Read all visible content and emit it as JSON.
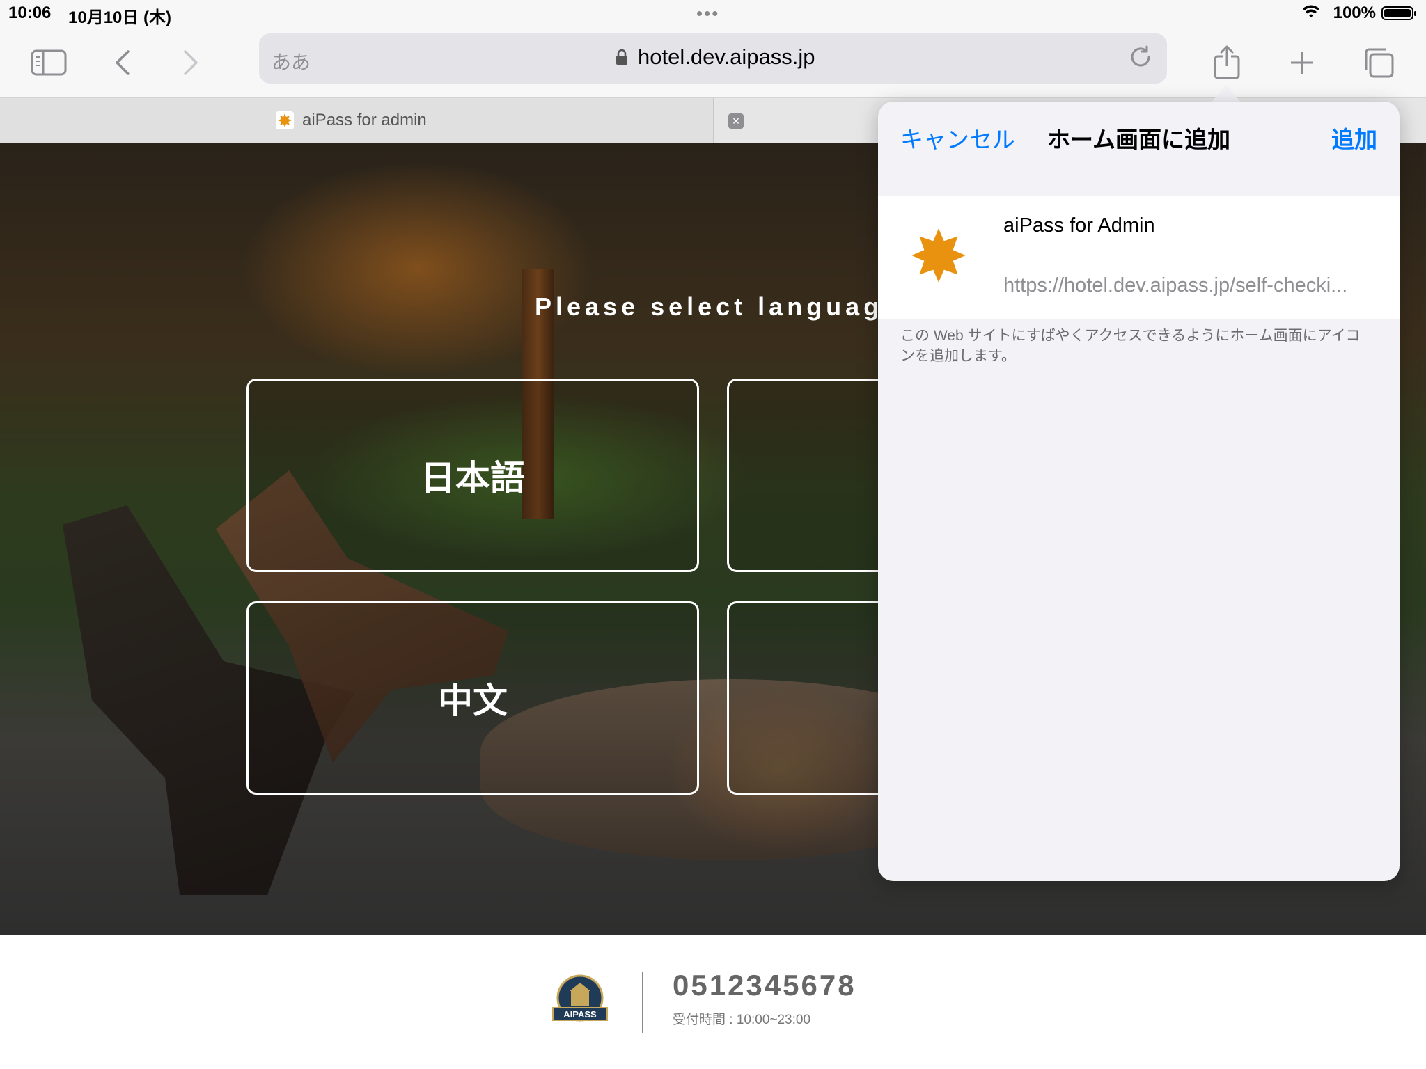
{
  "status_bar": {
    "time": "10:06",
    "date": "10月10日 (木)",
    "dots": "•••",
    "battery": "100%",
    "battery_level": 1.0
  },
  "browser": {
    "text_size_label": "ああ",
    "url": "hotel.dev.aipass.jp",
    "tab_title": "aiPass for admin",
    "tab_close": "×"
  },
  "page": {
    "prompt": "Please select language",
    "languages": [
      "日本語",
      "中文"
    ],
    "footer": {
      "phone": "0512345678",
      "hours": "受付時間 : 10:00~23:00",
      "logo_text": "AIPASS"
    }
  },
  "add_to_home_sheet": {
    "cancel": "キャンセル",
    "title": "ホーム画面に追加",
    "add": "追加",
    "app_name": "aiPass for Admin",
    "app_url": "https://hotel.dev.aipass.jp/self-checki...",
    "note": "この Web サイトにすばやくアクセスできるようにホーム画面にアイコンを追加します。"
  },
  "colors": {
    "ios_blue": "#007aff",
    "favicon": "#e8920f",
    "sheet_bg": "#f2f2f7"
  },
  "icons": [
    "sidebar-icon",
    "back-chevron-icon",
    "forward-chevron-icon",
    "lock-icon",
    "reload-icon",
    "share-icon",
    "plus-icon",
    "tabs-icon",
    "wifi-icon",
    "battery-icon",
    "sunburst-favicon-icon"
  ]
}
